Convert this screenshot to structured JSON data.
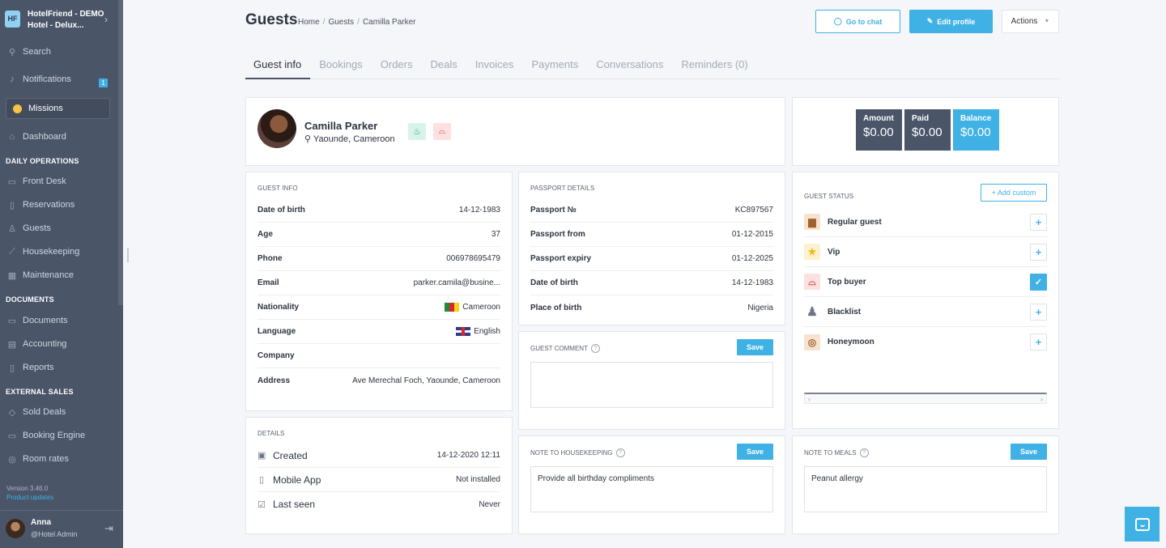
{
  "sidebar": {
    "hotel_name": "HotelFriend - DEMO",
    "hotel_sub": "Hotel - Delux...",
    "logo_text": "HF",
    "search": "Search",
    "notifications": "Notifications",
    "notifications_count": "1",
    "missions": "Missions",
    "dashboard": "Dashboard",
    "sec_daily": "DAILY OPERATIONS",
    "daily": [
      "Front Desk",
      "Reservations",
      "Guests",
      "Housekeeping",
      "Maintenance"
    ],
    "sec_documents": "DOCUMENTS",
    "documents": [
      "Documents",
      "Accounting",
      "Reports"
    ],
    "sec_external": "EXTERNAL SALES",
    "external": [
      "Sold Deals",
      "Booking Engine",
      "Room rates"
    ],
    "version": "Version 3.46.0",
    "product_updates": "Product updates",
    "user_name": "Anna",
    "user_role": "@Hotel Admin"
  },
  "header": {
    "title": "Guests",
    "breadcrumb": [
      "Home",
      "Guests",
      "Camilla Parker"
    ],
    "go_to_chat": "Go to chat",
    "edit_profile": "Edit profile",
    "actions": "Actions"
  },
  "tabs": [
    "Guest info",
    "Bookings",
    "Orders",
    "Deals",
    "Invoices",
    "Payments",
    "Conversations",
    "Reminders (0)"
  ],
  "profile": {
    "name": "Camilla Parker",
    "location": "Yaounde, Cameroon"
  },
  "finance": {
    "amount_label": "Amount",
    "amount": "$0.00",
    "paid_label": "Paid",
    "paid": "$0.00",
    "balance_label": "Balance",
    "balance": "$0.00"
  },
  "guest_info": {
    "heading": "GUEST INFO",
    "rows": [
      {
        "k": "Date of birth",
        "v": "14-12-1983"
      },
      {
        "k": "Age",
        "v": "37"
      },
      {
        "k": "Phone",
        "v": "006978695479"
      },
      {
        "k": "Email",
        "v": "parker.camila@busine..."
      },
      {
        "k": "Nationality",
        "v": "Cameroon"
      },
      {
        "k": "Language",
        "v": "English"
      },
      {
        "k": "Company",
        "v": ""
      },
      {
        "k": "Address",
        "v": "Ave Merechal Foch, Yaounde, Cameroon"
      }
    ]
  },
  "passport": {
    "heading": "PASSPORT DETAILS",
    "rows": [
      {
        "k": "Passport №",
        "v": "KC897567"
      },
      {
        "k": "Passport from",
        "v": "01-12-2015"
      },
      {
        "k": "Passport expiry",
        "v": "01-12-2025"
      },
      {
        "k": "Date of birth",
        "v": "14-12-1983"
      },
      {
        "k": "Place of birth",
        "v": "Nigeria"
      }
    ]
  },
  "guest_comment": {
    "heading": "GUEST COMMENT",
    "save": "Save",
    "value": ""
  },
  "details": {
    "heading": "DETAILS",
    "rows": [
      {
        "k": "Created",
        "v": "14-12-2020 12:11"
      },
      {
        "k": "Mobile App",
        "v": "Not installed"
      },
      {
        "k": "Last seen",
        "v": "Never"
      }
    ]
  },
  "housekeeping": {
    "heading": "NOTE TO HOUSEKEEPING",
    "save": "Save",
    "value": "Provide all birthday compliments"
  },
  "meals": {
    "heading": "NOTE TO MEALS",
    "save": "Save",
    "value": "Peanut allergy"
  },
  "guest_status": {
    "heading": "GUEST STATUS",
    "add_custom": "+ Add custom",
    "items": [
      {
        "label": "Regular guest",
        "checked": false,
        "icon": "suitcase-icon"
      },
      {
        "label": "Vip",
        "checked": false,
        "icon": "star-icon"
      },
      {
        "label": "Top buyer",
        "checked": true,
        "icon": "cloche-icon"
      },
      {
        "label": "Blacklist",
        "checked": false,
        "icon": "person-blocked-icon"
      },
      {
        "label": "Honeymoon",
        "checked": false,
        "icon": "ring-icon"
      }
    ]
  },
  "colors": {
    "accent": "#3fb1e5",
    "sidebar": "#4a5568",
    "dark_box": "#4a5568"
  }
}
